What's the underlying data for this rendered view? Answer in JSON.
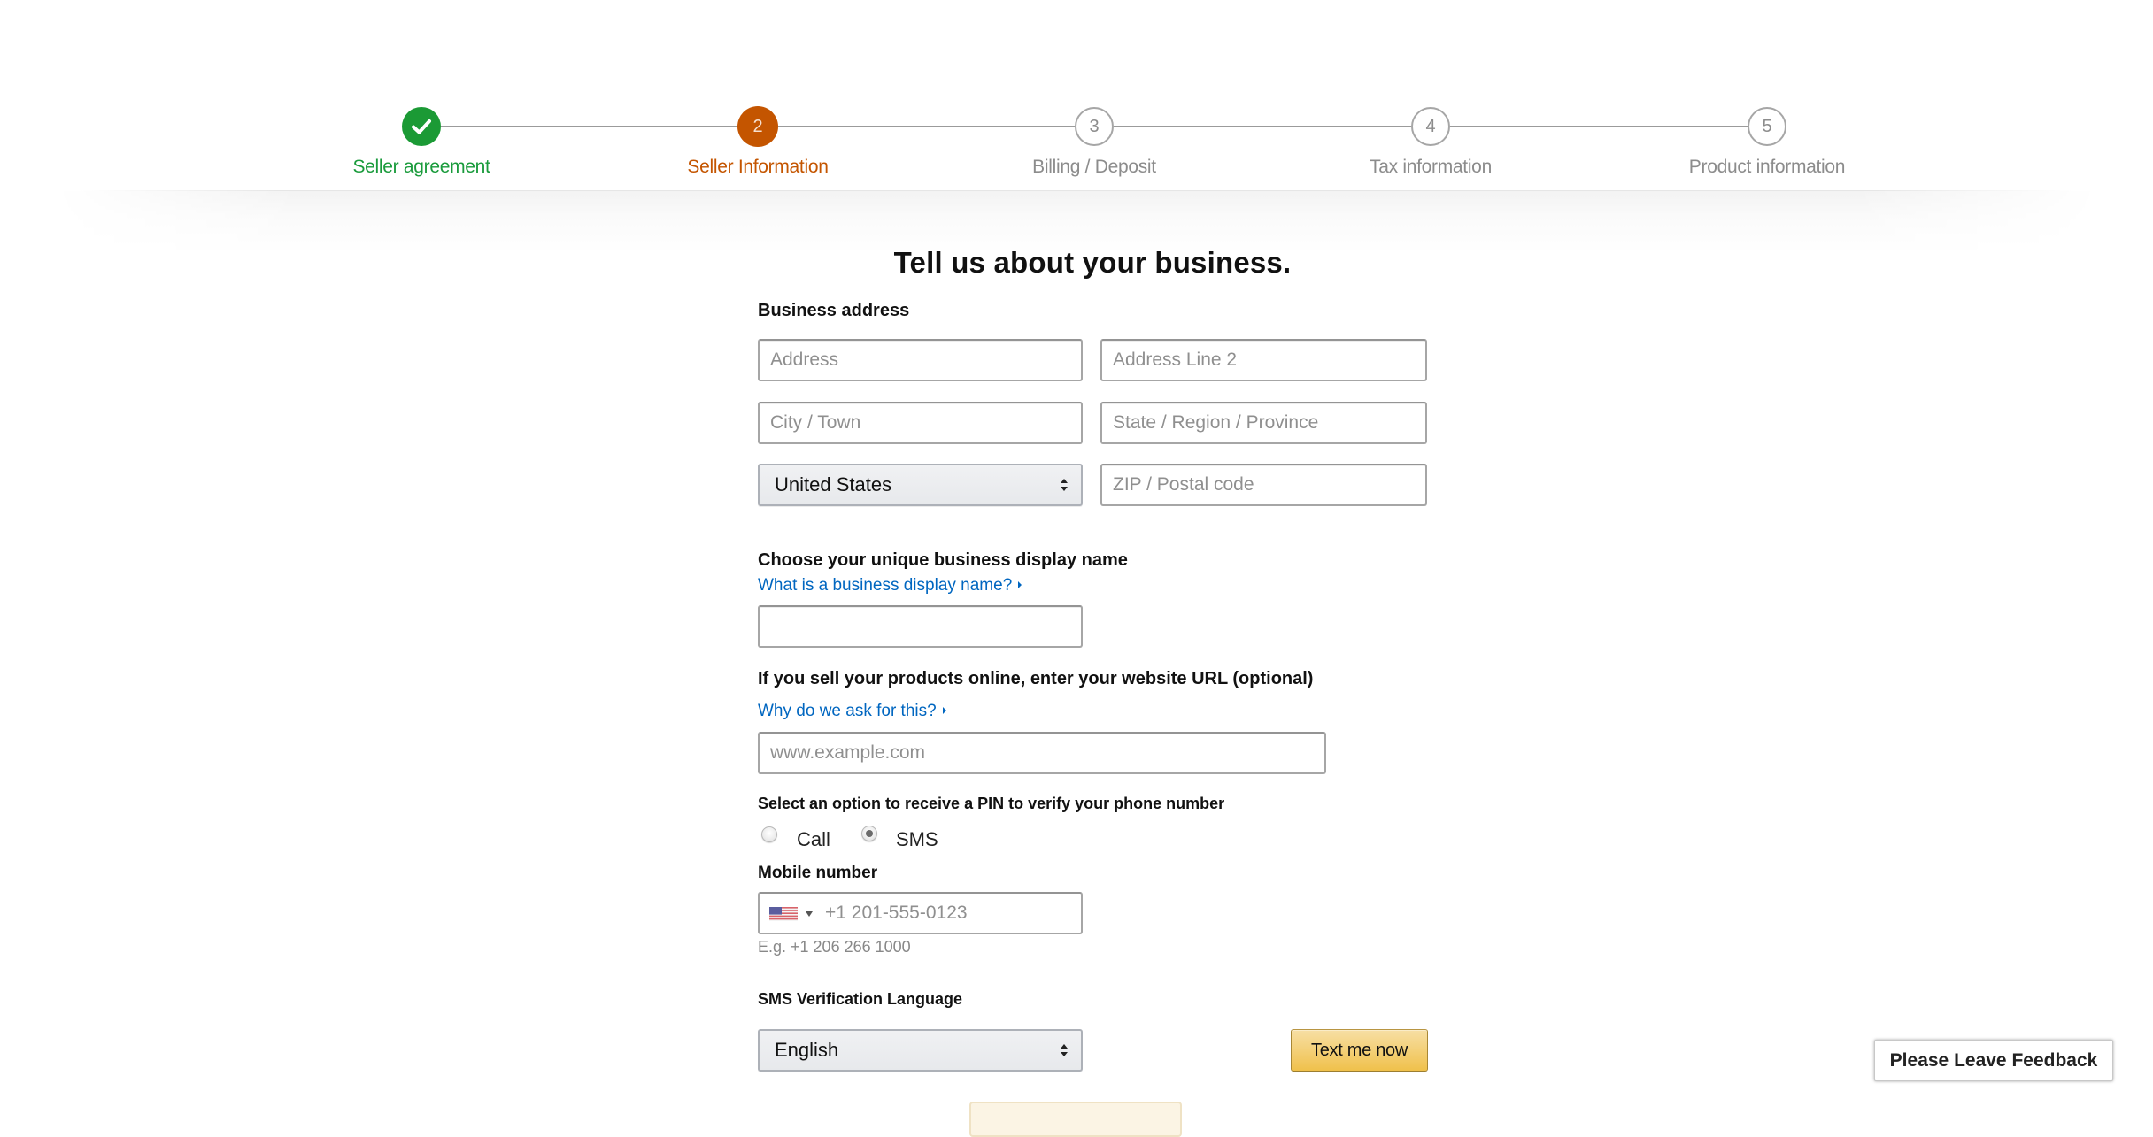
{
  "stepper": {
    "steps": [
      {
        "number": "1",
        "label": "Seller agreement",
        "status": "complete"
      },
      {
        "number": "2",
        "label": "Seller Information",
        "status": "current"
      },
      {
        "number": "3",
        "label": "Billing / Deposit",
        "status": "upcoming"
      },
      {
        "number": "4",
        "label": "Tax information",
        "status": "upcoming"
      },
      {
        "number": "5",
        "label": "Product information",
        "status": "upcoming"
      }
    ],
    "colors": {
      "complete": "#1b9a35",
      "current": "#c45500",
      "upcoming": "#8c8c8c"
    }
  },
  "form": {
    "title": "Tell us about your business.",
    "business_address": {
      "label": "Business address",
      "address_placeholder": "Address",
      "address_line2_placeholder": "Address Line 2",
      "city_placeholder": "City / Town",
      "state_placeholder": "State / Region / Province",
      "country_selected": "United States",
      "zip_placeholder": "ZIP / Postal code"
    },
    "display_name": {
      "label": "Choose your unique business display name",
      "help_link": "What is a business display name?",
      "value": ""
    },
    "website": {
      "label": "If you sell your products online, enter your website URL (optional)",
      "help_link": "Why do we ask for this?",
      "placeholder": "www.example.com",
      "value": ""
    },
    "pin_option": {
      "label": "Select an option to receive a PIN to verify your phone number",
      "options": [
        {
          "label": "Call",
          "checked": false
        },
        {
          "label": "SMS",
          "checked": true
        }
      ]
    },
    "mobile": {
      "label": "Mobile number",
      "country_flag": "us-flag-icon",
      "placeholder": "+1 201-555-0123",
      "hint": "E.g. +1 206 266 1000"
    },
    "sms_language": {
      "label": "SMS Verification Language",
      "selected": "English"
    },
    "text_me_button": "Text me now"
  },
  "feedback_button": "Please Leave Feedback",
  "colors": {
    "link": "#0066c0",
    "primary_button_top": "#f7dfa5",
    "primary_button_bottom": "#f0c14b"
  }
}
